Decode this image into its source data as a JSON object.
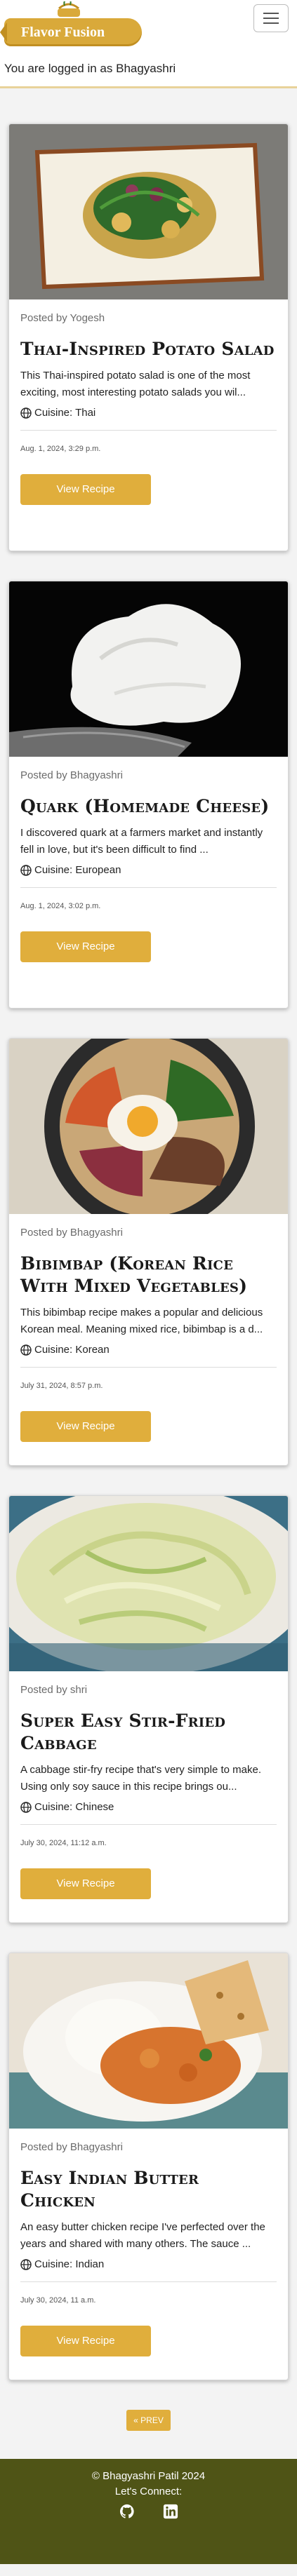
{
  "brand": {
    "name": "Flavor Fusion"
  },
  "session": {
    "logged_in_text": "You are logged in as Bhagyashri"
  },
  "cards": [
    {
      "posted_by": "Posted by Yogesh",
      "title": "Thai-Inspired Potato Salad",
      "description": "This Thai-inspired potato salad is one of the most exciting, most interesting potato salads you wil...",
      "cuisine": "Cuisine: Thai",
      "date": "Aug. 1, 2024, 3:29 p.m.",
      "button": "View Recipe"
    },
    {
      "posted_by": "Posted by Bhagyashri",
      "title": "Quark (Homemade Cheese)",
      "description": "I discovered quark at a farmers market and instantly fell in love, but it's been difficult to find ...",
      "cuisine": "Cuisine: European",
      "date": "Aug. 1, 2024, 3:02 p.m.",
      "button": "View Recipe"
    },
    {
      "posted_by": "Posted by Bhagyashri",
      "title": "Bibimbap (Korean Rice With Mixed Vegetables)",
      "description": "This bibimbap recipe makes a popular and delicious Korean meal. Meaning mixed rice, bibimbap is a d...",
      "cuisine": "Cuisine: Korean",
      "date": "July 31, 2024, 8:57 p.m.",
      "button": "View Recipe"
    },
    {
      "posted_by": "Posted by shri",
      "title": "Super Easy Stir-Fried Cabbage",
      "description": "A cabbage stir-fry recipe that's very simple to make. Using only soy sauce in this recipe brings ou...",
      "cuisine": "Cuisine: Chinese",
      "date": "July 30, 2024, 11:12 a.m.",
      "button": "View Recipe"
    },
    {
      "posted_by": "Posted by Bhagyashri",
      "title": "Easy Indian Butter Chicken",
      "description": "An easy butter chicken recipe I've perfected over the years and shared with many others. The sauce ...",
      "cuisine": "Cuisine: Indian",
      "date": "July 30, 2024, 11 a.m.",
      "button": "View Recipe"
    }
  ],
  "pagination": {
    "prev": "« PREV"
  },
  "footer": {
    "copyright": "© Bhagyashri Patil 2024",
    "connect": "Let's Connect:",
    "icons": [
      "github-icon",
      "linkedin-icon"
    ]
  },
  "colors": {
    "accent": "#e0ae3c",
    "footer": "#4f5416"
  }
}
